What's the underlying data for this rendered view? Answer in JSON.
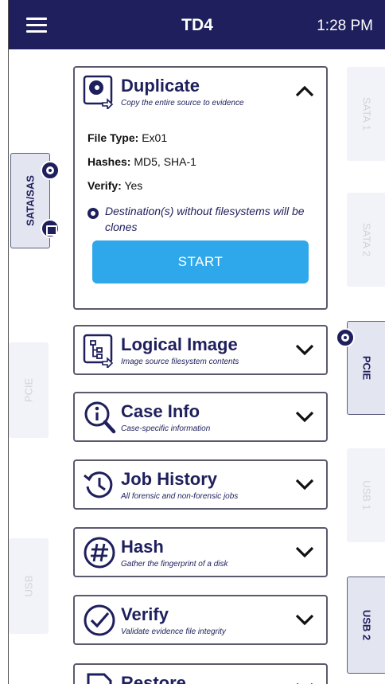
{
  "header": {
    "title": "TD4",
    "time": "1:28 PM"
  },
  "ports": {
    "left": [
      {
        "label": "SATA/SAS",
        "state": "active"
      },
      {
        "label": "PCIE",
        "state": "inactive"
      },
      {
        "label": "USB",
        "state": "inactive"
      }
    ],
    "right": [
      {
        "label": "SATA 1",
        "state": "inactive"
      },
      {
        "label": "SATA 2",
        "state": "inactive"
      },
      {
        "label": "PCIE",
        "state": "active"
      },
      {
        "label": "USB 1",
        "state": "inactive"
      },
      {
        "label": "USB 2",
        "state": "active"
      }
    ]
  },
  "duplicate": {
    "title": "Duplicate",
    "subtitle": "Copy the entire source to evidence",
    "file_type_label": "File Type:",
    "file_type_value": "Ex01",
    "hashes_label": "Hashes:",
    "hashes_value": "MD5, SHA-1",
    "verify_label": "Verify:",
    "verify_value": "Yes",
    "note": "Destination(s) without filesystems will be clones",
    "start_label": "START",
    "icon": "disk-copy-icon"
  },
  "cards": [
    {
      "title": "Logical Image",
      "subtitle": "Image source filesystem contents",
      "icon": "tree-icon"
    },
    {
      "title": "Case Info",
      "subtitle": "Case-specific information",
      "icon": "info-magnifier-icon"
    },
    {
      "title": "Job History",
      "subtitle": "All forensic and non-forensic jobs",
      "icon": "history-icon"
    },
    {
      "title": "Hash",
      "subtitle": "Gather the fingerprint of a disk",
      "icon": "hash-icon"
    },
    {
      "title": "Verify",
      "subtitle": "Validate evidence file integrity",
      "icon": "check-circle-icon"
    },
    {
      "title": "Restore",
      "subtitle": "",
      "icon": "restore-icon"
    }
  ],
  "colors": {
    "header_bg": "#1e1f5c",
    "accent": "#2ea8ea",
    "text": "#1e1f5c"
  }
}
